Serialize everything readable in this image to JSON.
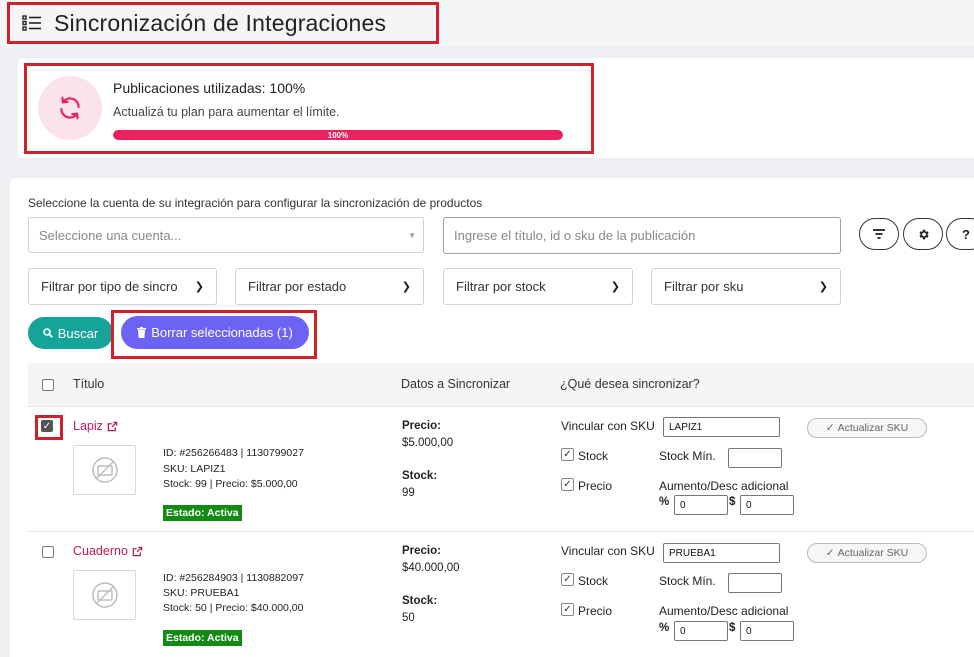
{
  "header": {
    "title": "Sincronización de Integraciones",
    "menu_icon": "list-icon"
  },
  "plan": {
    "icon": "sync-icon",
    "title": "Publicaciones utilizadas: 100%",
    "subtitle": "Actualizá tu plan para aumentar el límite.",
    "progress_label": "100%",
    "progress_value": 100,
    "accent_color": "#e9215f"
  },
  "filters": {
    "instructions": "Seleccione la cuenta de su integración para configurar la sincronización de productos",
    "account_placeholder": "Seleccione una cuenta...",
    "search_placeholder": "Ingrese el título, id o sku de la publicación",
    "sync_type": "Filtrar por tipo de sincro",
    "status": "Filtrar por estado",
    "stock": "Filtrar por stock",
    "sku": "Filtrar por sku",
    "filter_icon": "filter-icon",
    "settings_icon": "gear-icon",
    "help_label": "?"
  },
  "actions": {
    "search_label": "Buscar",
    "delete_label": "Borrar seleccionadas (1)"
  },
  "table": {
    "col_title": "Título",
    "col_data": "Datos a Sincronizar",
    "col_sync": "¿Qué desea sincronizar?"
  },
  "labels": {
    "precio": "Precio:",
    "stock": "Stock:",
    "vincular": "Vincular con SKU",
    "stock_opt": "Stock",
    "precio_opt": "Precio",
    "stock_min": "Stock Mín.",
    "aumento": "Aumento/Desc adicional",
    "pct": "%",
    "dollar": "$",
    "update_sku": "Actualizar SKU"
  },
  "products": [
    {
      "title": "Lapiz",
      "checked": true,
      "id_line": "ID: #256266483 | 1130799027",
      "sku_line": "SKU: LAPIZ1",
      "stock_line": "Stock: 99 | Precio: $5.000,00",
      "status": "Estado: Activa",
      "price": "$5.000,00",
      "stock": "99",
      "sku_value": "LAPIZ1",
      "sync_stock": true,
      "sync_price": true,
      "stock_min": "",
      "pct_value": "0",
      "dollar_value": "0"
    },
    {
      "title": "Cuaderno",
      "checked": false,
      "id_line": "ID: #256284903 | 1130882097",
      "sku_line": "SKU: PRUEBA1",
      "stock_line": "Stock: 50 | Precio: $40.000,00",
      "status": "Estado: Activa",
      "price": "$40.000,00",
      "stock": "50",
      "sku_value": "PRUEBA1",
      "sync_stock": true,
      "sync_price": true,
      "stock_min": "",
      "pct_value": "0",
      "dollar_value": "0"
    }
  ]
}
